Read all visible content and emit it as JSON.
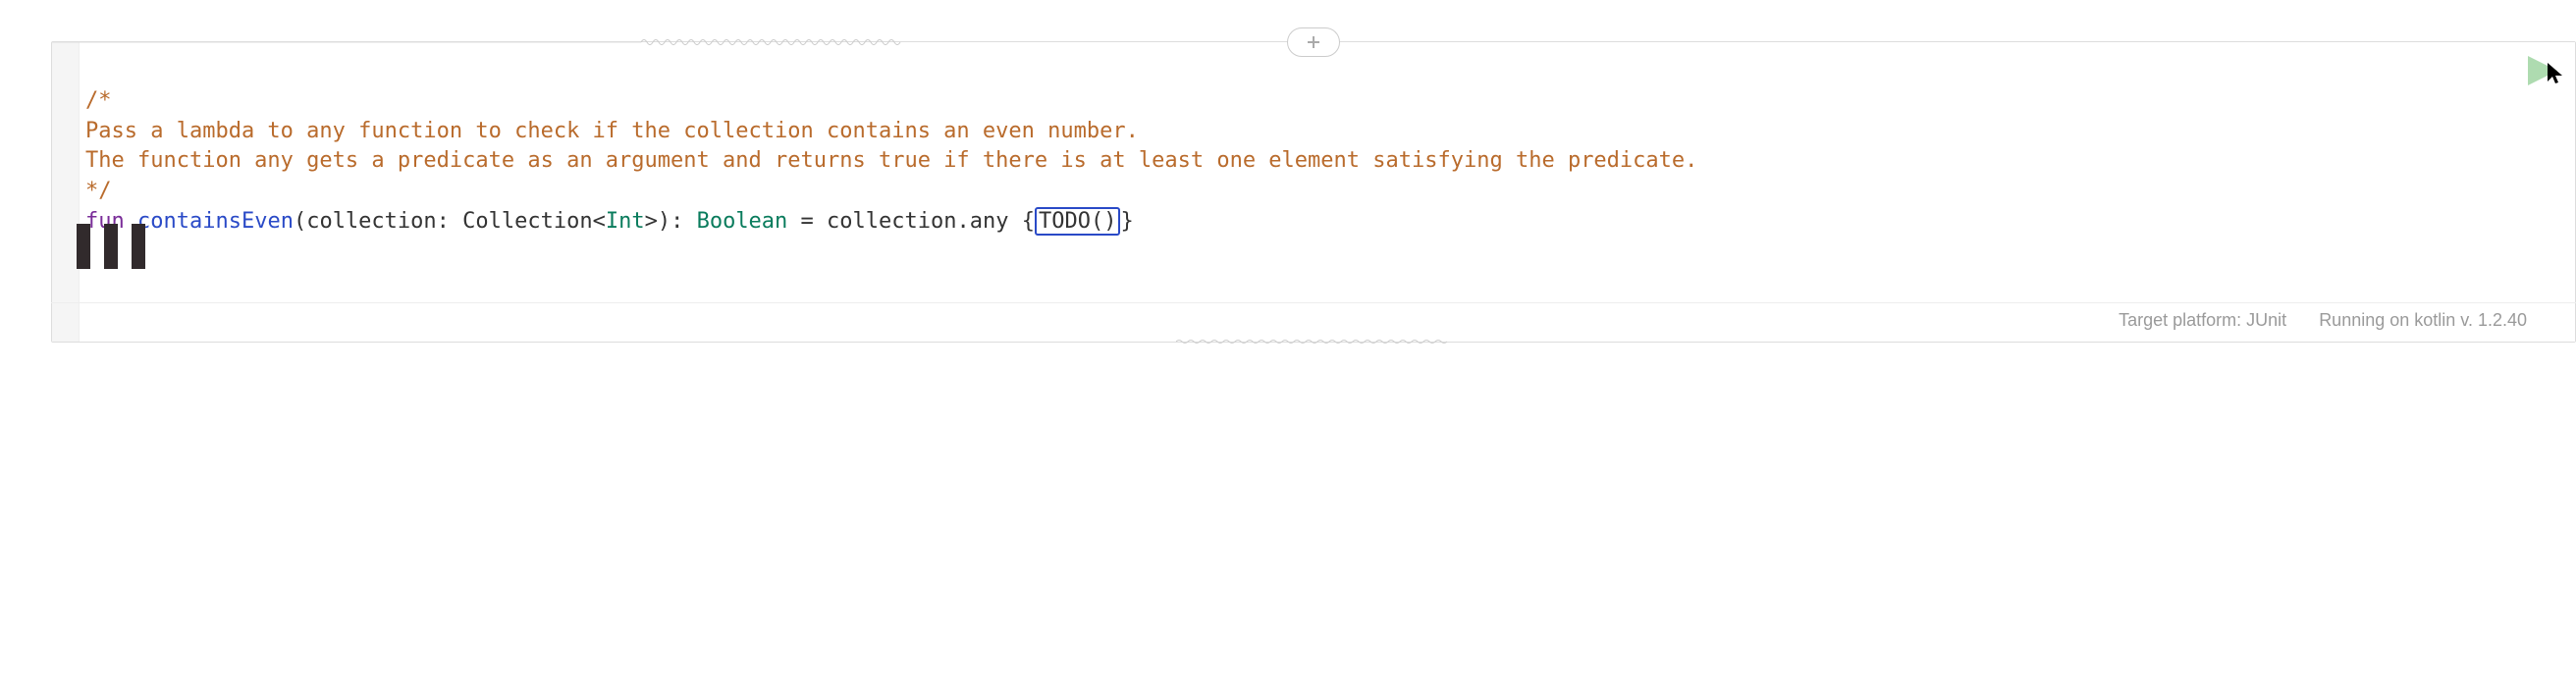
{
  "code": {
    "comment_open": "/*",
    "comment_line1": "Pass a lambda to any function to check if the collection contains an even number.",
    "comment_line2": "The function any gets a predicate as an argument and returns true if there is at least one element satisfying the predicate.",
    "comment_close": "*/",
    "keyword_fun": "fun",
    "function_name": "containsEven",
    "sig_open": "(collection: Collection<",
    "type_int": "Int",
    "sig_close": ">): ",
    "return_type": "Boolean",
    "eq_expr_start": " = collection.any {",
    "todo_call": "TODO()",
    "brace_close": "}"
  },
  "icons": {
    "run": "play-icon",
    "expand": "plus-icon",
    "loading": "loading-bars-icon",
    "cursor": "mouse-pointer-icon"
  },
  "footer": {
    "platform": "Target platform: JUnit",
    "runtime": "Running on kotlin v. 1.2.40"
  }
}
